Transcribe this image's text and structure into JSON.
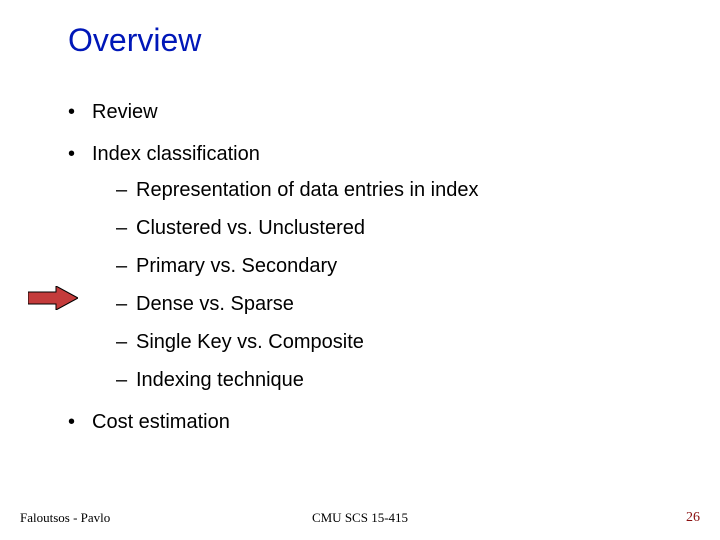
{
  "title": "Overview",
  "bullets": {
    "b1": "Review",
    "b2": "Index classification",
    "b2_subs": {
      "s1": "Representation of data entries in index",
      "s2": "Clustered vs. Unclustered",
      "s3": "Primary vs. Secondary",
      "s4": "Dense vs. Sparse",
      "s5": "Single Key vs. Composite",
      "s6": "Indexing technique"
    },
    "b3": "Cost estimation"
  },
  "footer": {
    "left": "Faloutsos - Pavlo",
    "center": "CMU SCS 15-415",
    "right": "26"
  },
  "colors": {
    "title": "#0017b8",
    "accent": "#c43b3b",
    "pagenum": "#8a0f0f"
  }
}
